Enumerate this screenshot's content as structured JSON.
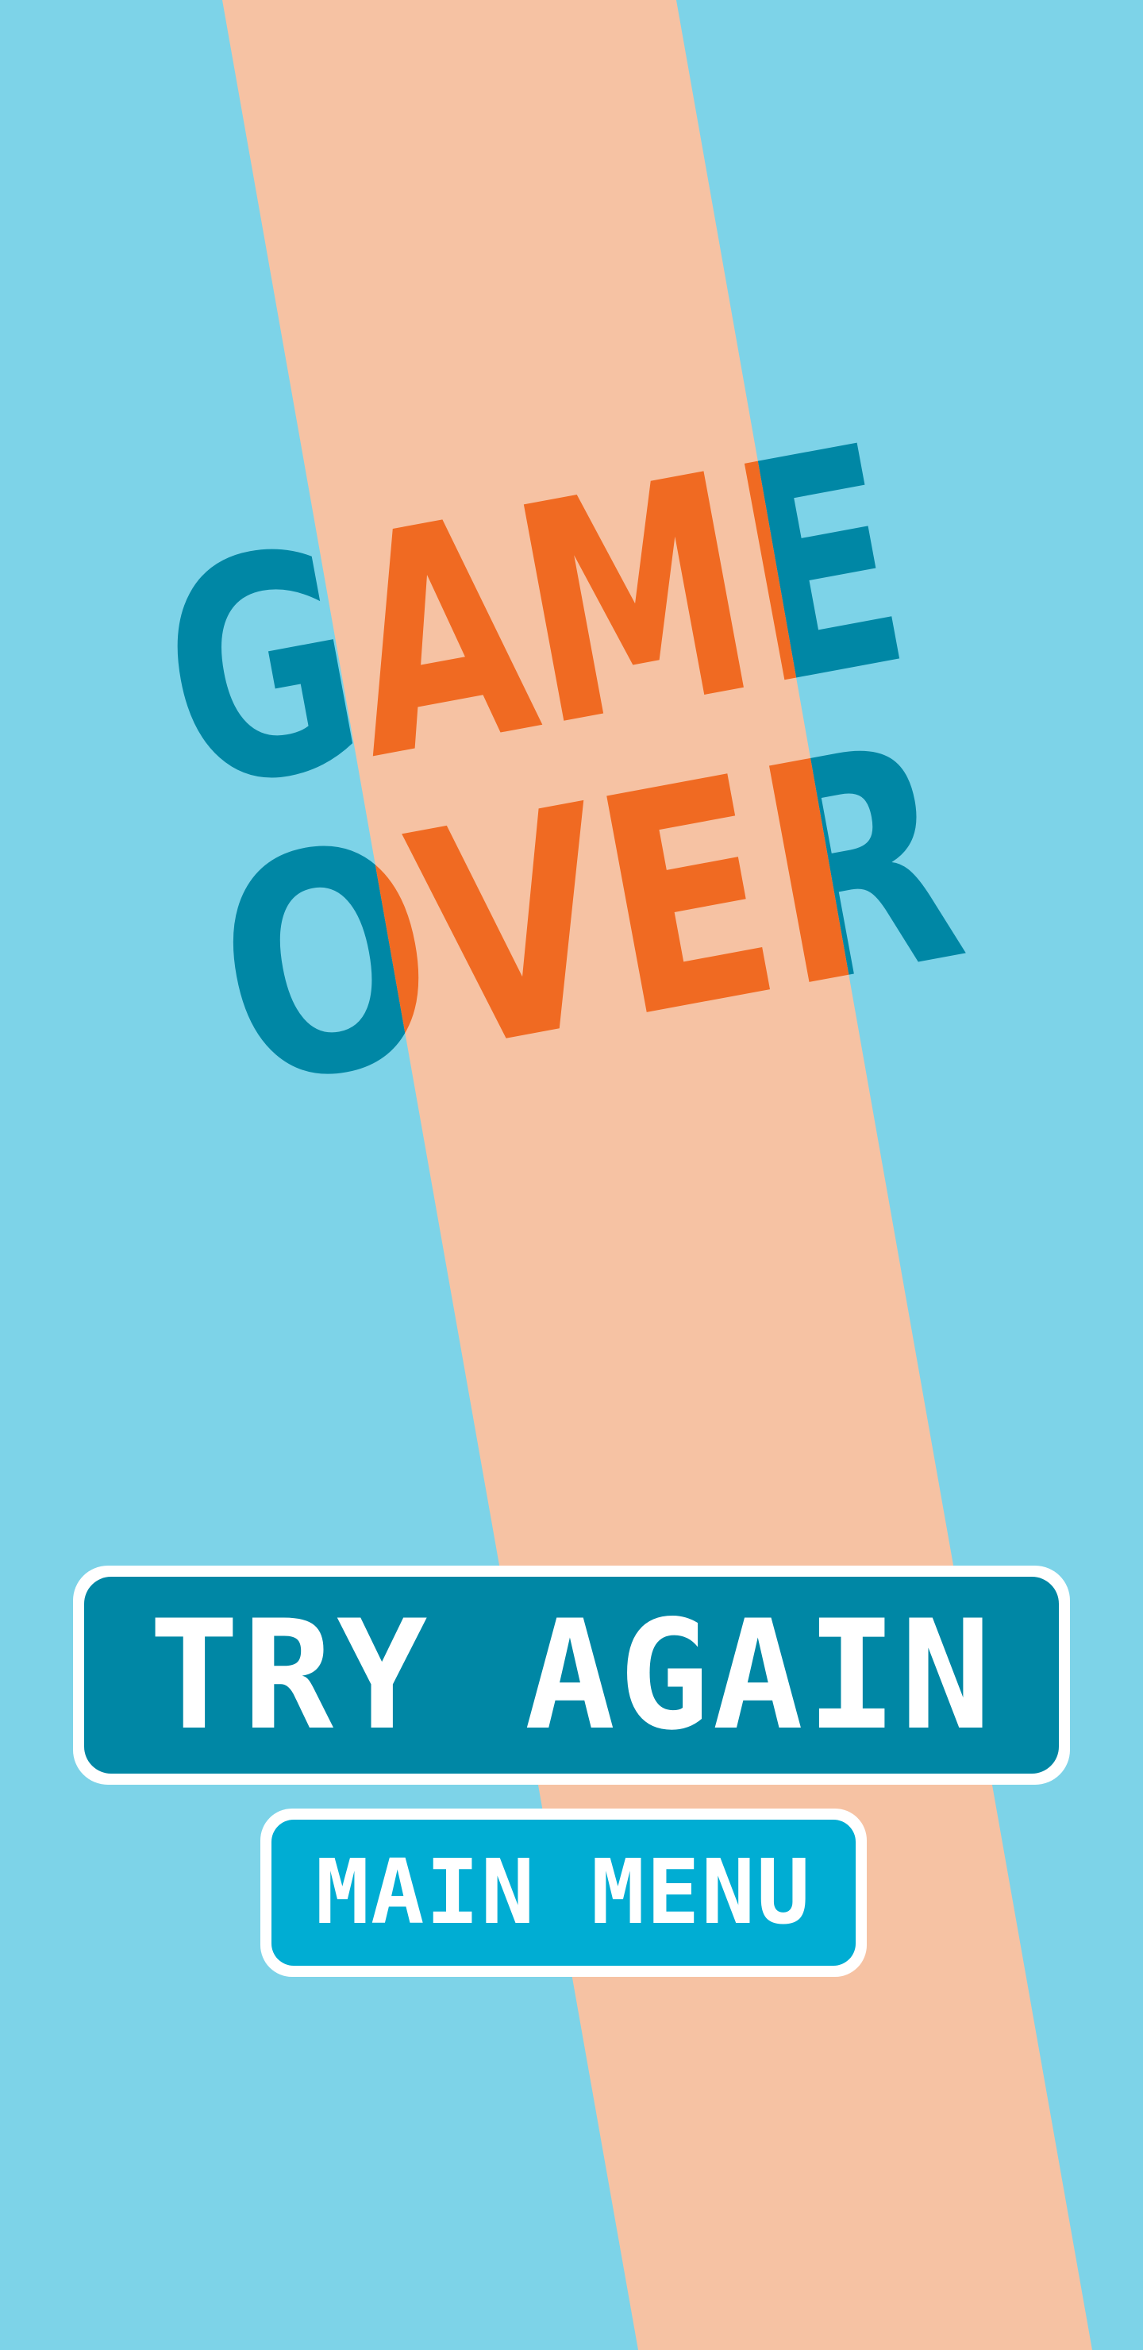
{
  "screen": "game-over",
  "title": {
    "line1": "GAME",
    "line2": "OVER"
  },
  "buttons": {
    "try_again_label": "TRY AGAIN",
    "main_menu_label": "MAIN MENU"
  },
  "colors": {
    "background": "#7dd3e8",
    "stripe": "#f6c2a3",
    "title_on_background": "#0087a5",
    "title_on_stripe": "#f06a22",
    "try_again_fill": "#0087a5",
    "main_menu_fill": "#00add3",
    "button_border": "#ffffff",
    "button_text": "#ffffff"
  }
}
